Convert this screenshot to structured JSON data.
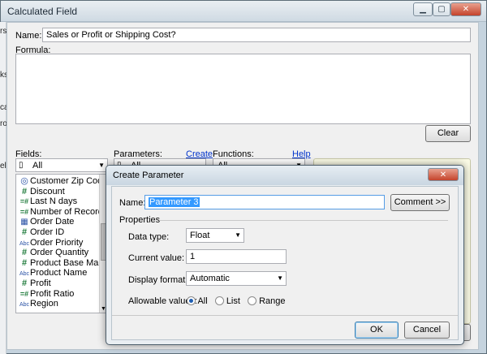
{
  "calc_window": {
    "title": "Calculated Field",
    "controls": {
      "minimize": "▁",
      "maximize": "▢",
      "close": "✕"
    },
    "name_label": "Name:",
    "name_value": "Sales or Profit or Shipping Cost?",
    "formula_label": "Formula:",
    "clear_label": "Clear",
    "fields_label": "Fields:",
    "fields_filter": "All",
    "parameters_label": "Parameters:",
    "parameters_filter": "All",
    "create_link": "Create",
    "functions_label": "Functions:",
    "functions_filter": "All",
    "help_link": "Help",
    "fields": [
      {
        "icon": "globe",
        "label": "Customer Zip Code"
      },
      {
        "icon": "#",
        "label": "Discount"
      },
      {
        "icon": "=#",
        "label": "Last N days"
      },
      {
        "icon": "=#",
        "label": "Number of Records"
      },
      {
        "icon": "cal",
        "label": "Order Date"
      },
      {
        "icon": "#",
        "label": "Order ID"
      },
      {
        "icon": "Abc",
        "label": "Order Priority"
      },
      {
        "icon": "#",
        "label": "Order Quantity"
      },
      {
        "icon": "#",
        "label": "Product Base Margin"
      },
      {
        "icon": "Abc",
        "label": "Product Name"
      },
      {
        "icon": "#",
        "label": "Profit"
      },
      {
        "icon": "=#",
        "label": "Profit Ratio"
      },
      {
        "icon": "Abc",
        "label": "Region"
      }
    ]
  },
  "background_strip": {
    "texts": [
      "rs",
      "ks",
      "ca",
      "ro",
      "el"
    ]
  },
  "param_dialog": {
    "title": "Create Parameter",
    "close": "✕",
    "name_label": "Name:",
    "name_value": "Parameter 3",
    "comment_button": "Comment >>",
    "properties_label": "Properties",
    "data_type_label": "Data type:",
    "data_type_value": "Float",
    "current_value_label": "Current value:",
    "current_value": "1",
    "display_format_label": "Display format:",
    "display_format_value": "Automatic",
    "allowable_values_label": "Allowable values:",
    "allowable_options": [
      "All",
      "List",
      "Range"
    ],
    "allowable_selected": "All",
    "ok_label": "OK",
    "cancel_label": "Cancel"
  }
}
